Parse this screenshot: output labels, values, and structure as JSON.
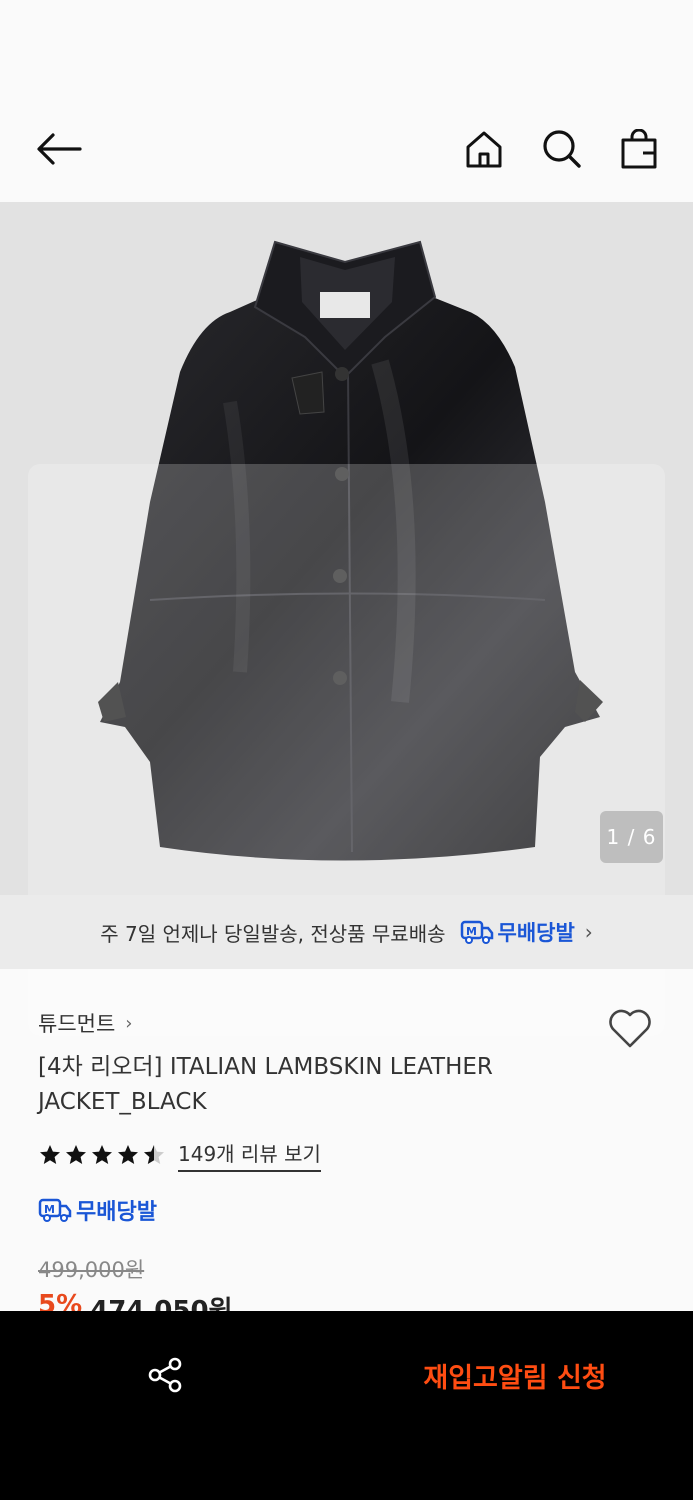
{
  "header": {
    "back_icon": "arrow-left-icon",
    "home_icon": "home-icon",
    "search_icon": "search-icon",
    "bag_icon": "shopping-bag-icon"
  },
  "gallery": {
    "counter": "1 / 6"
  },
  "shipping_banner": {
    "text": "주 7일 언제나 당일발송, 전상품 무료배송",
    "badge_label": "무배당발",
    "accent_color": "#1a56d6"
  },
  "product": {
    "brand": "튜드먼트",
    "title": "[4차 리오더] ITALIAN LAMBSKIN LEATHER JACKET_BLACK",
    "rating": 4.5,
    "reviews_label": "149개 리뷰 보기",
    "badge_label": "무배당발",
    "original_price": "499,000원",
    "discount": "5%",
    "sale_price": "474,050원"
  },
  "bottom_bar": {
    "share_icon": "share-icon",
    "restock_label": "재입고알림 신청",
    "restock_color": "#ff4d12"
  }
}
